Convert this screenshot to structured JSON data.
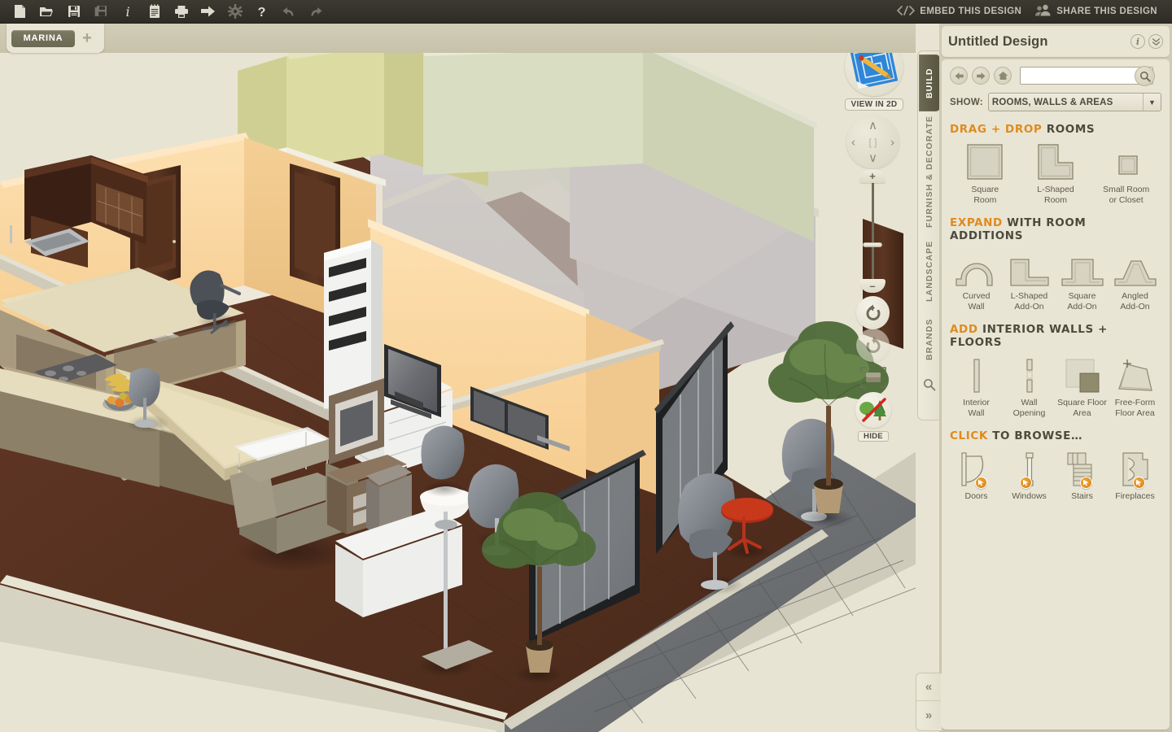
{
  "toolbar": {
    "icons": [
      {
        "name": "new-document-icon",
        "label": "New",
        "dim": false
      },
      {
        "name": "open-folder-icon",
        "label": "Open",
        "dim": false
      },
      {
        "name": "save-icon",
        "label": "Save",
        "dim": false
      },
      {
        "name": "save-as-icon",
        "label": "Save As",
        "dim": true
      },
      {
        "name": "info-icon",
        "label": "Info",
        "dim": false
      },
      {
        "name": "notes-icon",
        "label": "Notes",
        "dim": false
      },
      {
        "name": "print-icon",
        "label": "Print",
        "dim": false
      },
      {
        "name": "export-icon",
        "label": "Export",
        "dim": false
      },
      {
        "name": "settings-gear-icon",
        "label": "Settings",
        "dim": true
      },
      {
        "name": "help-icon",
        "label": "Help",
        "dim": false
      },
      {
        "name": "undo-icon",
        "label": "Undo",
        "dim": true
      },
      {
        "name": "redo-icon",
        "label": "Redo",
        "dim": true
      }
    ],
    "embed_label": "EMBED THIS DESIGN",
    "share_label": "SHARE THIS DESIGN"
  },
  "tabs": {
    "documents": [
      "MARINA"
    ],
    "add_label": "+"
  },
  "view_controls": {
    "view_2d_label": "VIEW IN 2D",
    "hide_label": "HIDE",
    "zoom_plus": "+",
    "zoom_minus": "–",
    "dpad": {
      "up": "∧",
      "down": "∨",
      "left": "‹",
      "right": "›",
      "center": "[ ]"
    }
  },
  "rail": {
    "tabs": [
      {
        "label": "BUILD",
        "active": true
      },
      {
        "label": "FURNISH & DECORATE",
        "active": false
      },
      {
        "label": "LANDSCAPE",
        "active": false
      },
      {
        "label": "BRANDS",
        "active": false
      }
    ],
    "search_icon": "search-icon"
  },
  "panel": {
    "title": "Untitled Design",
    "info_icon": "i",
    "collapse_icon": "»",
    "nav": {
      "back_icon": "arrow-left-icon",
      "forward_icon": "arrow-right-icon",
      "home_icon": "home-icon"
    },
    "search": {
      "value": "",
      "placeholder": ""
    },
    "show": {
      "label": "SHOW:",
      "selected": "ROOMS, WALLS & AREAS",
      "options": [
        "ROOMS, WALLS & AREAS"
      ]
    },
    "sections": [
      {
        "title_hi": "DRAG + DROP",
        "title_rest": "ROOMS",
        "kind": "rooms",
        "items": [
          {
            "name": "square-room",
            "label": "Square\nRoom",
            "art": "square"
          },
          {
            "name": "l-shaped-room",
            "label": "L-Shaped\nRoom",
            "art": "lshape"
          },
          {
            "name": "small-room-or-closet",
            "label": "Small Room\nor Closet",
            "art": "small"
          }
        ]
      },
      {
        "title_hi": "EXPAND",
        "title_rest": "WITH ROOM ADDITIONS",
        "kind": "additions",
        "items": [
          {
            "name": "curved-wall",
            "label": "Curved\nWall",
            "art": "curved"
          },
          {
            "name": "l-shaped-add-on",
            "label": "L-Shaped\nAdd-On",
            "art": "ladd"
          },
          {
            "name": "square-add-on",
            "label": "Square\nAdd-On",
            "art": "sqadd"
          },
          {
            "name": "angled-add-on",
            "label": "Angled\nAdd-On",
            "art": "angadd"
          }
        ]
      },
      {
        "title_hi": "ADD",
        "title_rest": "INTERIOR WALLS + FLOORS",
        "kind": "walls",
        "items": [
          {
            "name": "interior-wall",
            "label": "Interior\nWall",
            "art": "iwall"
          },
          {
            "name": "wall-opening",
            "label": "Wall\nOpening",
            "art": "wopening"
          },
          {
            "name": "square-floor-area",
            "label": "Square Floor\nArea",
            "art": "sqfloor"
          },
          {
            "name": "free-form-floor-area",
            "label": "Free-Form\nFloor Area",
            "art": "ffloor"
          }
        ]
      },
      {
        "title_hi": "CLICK",
        "title_rest": "TO BROWSE…",
        "kind": "browse",
        "items": [
          {
            "name": "doors",
            "label": "Doors",
            "art": "door",
            "badge": true
          },
          {
            "name": "windows",
            "label": "Windows",
            "art": "window",
            "badge": true
          },
          {
            "name": "stairs",
            "label": "Stairs",
            "art": "stairs",
            "badge": true
          },
          {
            "name": "fireplaces",
            "label": "Fireplaces",
            "art": "fireplace",
            "badge": true
          }
        ]
      }
    ]
  },
  "collapse": {
    "left_icon": "«",
    "right_icon": "»"
  },
  "colors": {
    "accent_orange": "#e08a1e",
    "toolbar_dark": "#35332b",
    "panel_bg": "#e8e5d4",
    "canvas_bg": "#e8e4d3",
    "tab_active": "#6b6853",
    "wall_cream": "#f5f0e6",
    "wall_green": "#d4dcc0",
    "wall_yellow": "#d8d79c",
    "wall_orange": "#fbd9a3",
    "wall_gray": "#c9c5c4",
    "floor_wood": "#5c3222",
    "terrace_tile": "#6f7174"
  }
}
